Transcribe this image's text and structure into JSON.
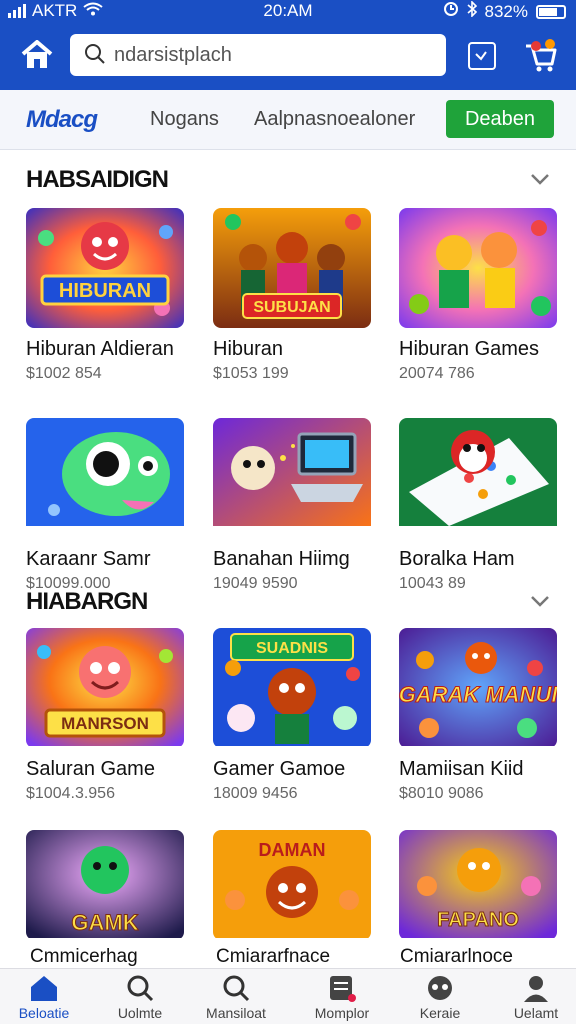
{
  "status_bar": {
    "carrier": "AKTR",
    "time": "20:AM",
    "battery": "832%"
  },
  "header": {
    "search_placeholder": "ndarsistplach"
  },
  "subnav": {
    "logo": "Mdacg",
    "tab_1": "Nogans",
    "tab_2": "Aalpnasnoealoner",
    "cta": "Deaben"
  },
  "sections": [
    {
      "title": "HABSAIDIGN"
    },
    {
      "title": "HIABARGN"
    }
  ],
  "cards": [
    {
      "name": "Hiburan Aldieran",
      "meta": "$1002 854",
      "art": "HIBURAN"
    },
    {
      "name": "Hiburan",
      "meta": "$1053 199",
      "art": "SUBUJAN"
    },
    {
      "name": "Hiburan Games",
      "meta": "20074 786",
      "art": ""
    },
    {
      "name": "Karaanr Samr",
      "meta": "$10099.000",
      "art": ""
    },
    {
      "name": "Banahan Hiimg",
      "meta": "19049 9590",
      "art": ""
    },
    {
      "name": "Boralka Ham",
      "meta": "10043 89",
      "art": ""
    },
    {
      "name": "Saluran Game",
      "meta": "$1004.3.956",
      "art": "MANRSON"
    },
    {
      "name": "Gamer Gamoe",
      "meta": "18009 9456",
      "art": "SUADNIS"
    },
    {
      "name": "Mamiisan Kiid",
      "meta": "$8010 9086",
      "art": "GARAK MANUI"
    }
  ],
  "partial_row": {
    "labels": [
      "Cmmicerhag",
      "Cmiararfnace",
      "Cmiararlnoce"
    ],
    "art": [
      "GAMK",
      "DAMAN",
      "FAPANO"
    ]
  },
  "bottom_nav": [
    {
      "label": "Beloatie",
      "icon": "home-icon",
      "active": true
    },
    {
      "label": "Uolmte",
      "icon": "search-icon",
      "active": false
    },
    {
      "label": "Mansiloat",
      "icon": "search-icon",
      "active": false
    },
    {
      "label": "Momplor",
      "icon": "document-icon",
      "active": false
    },
    {
      "label": "Keraie",
      "icon": "controller-icon",
      "active": false
    },
    {
      "label": "Uelamt",
      "icon": "user-icon",
      "active": false
    }
  ],
  "colors": {
    "brand": "#1a4fc4",
    "cta": "#1fa33a",
    "nav_active": "#1a4fc4"
  }
}
